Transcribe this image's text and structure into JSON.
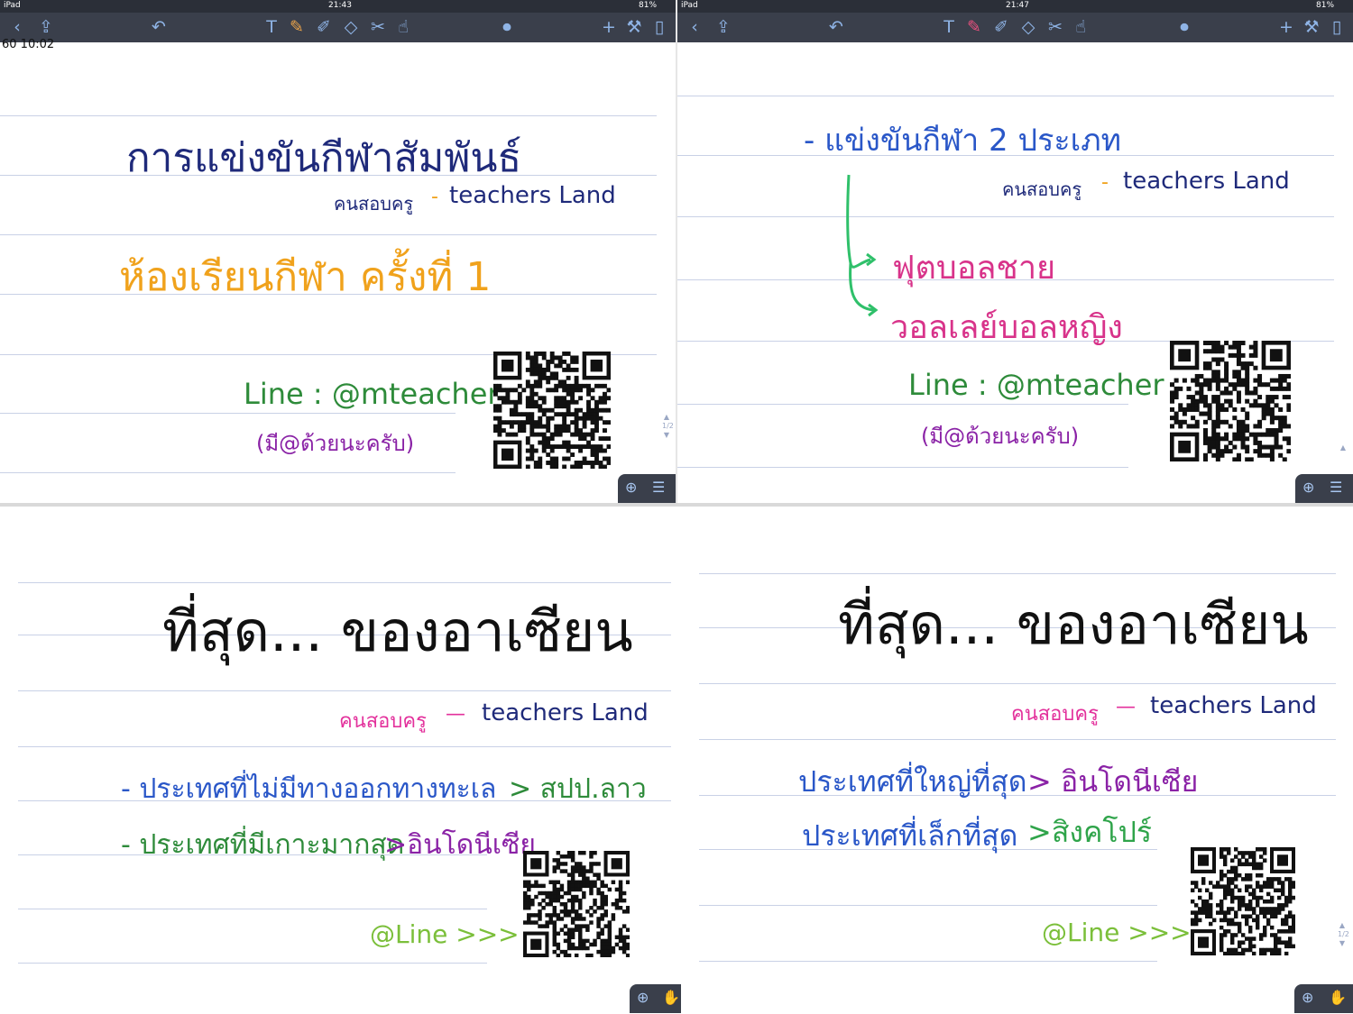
{
  "colors": {
    "toolbar_bg": "#3a3f4b",
    "status_bg": "#2b2f38",
    "rule_line": "#c9d1e6",
    "navy_ink": "#1f2a7a",
    "orange_ink": "#f0a21c",
    "green_ink": "#2e8b3a",
    "purple_ink": "#8a22a6",
    "blue_ink": "#2a57c8",
    "pink_ink": "#d8338a",
    "lime_ink": "#7bbf3a"
  },
  "panel1": {
    "status": {
      "device": "iPad",
      "time": "21:43",
      "battery": "81%"
    },
    "toolbar": {
      "icons": [
        "back-icon",
        "share-icon",
        "undo-icon",
        "text-tool-icon",
        "pencil-icon",
        "highlighter-icon",
        "eraser-icon",
        "lasso-icon",
        "shape-icon",
        "mic-icon",
        "add-icon",
        "wrench-icon",
        "pages-icon"
      ]
    },
    "corner_text": "60 10:02",
    "title": "การแข่งขันกีฬาสัมพันธ์",
    "credit_thai": "คนสอบครู",
    "credit_dash": "-",
    "credit_en": "teachers Land",
    "subtitle": "ห้องเรียนกีฬา ครั้งที่ 1",
    "line_id": "Line : @mteacher",
    "line_note": "(มี@ด้วยนะครับ)"
  },
  "panel2": {
    "status": {
      "device": "iPad",
      "time": "21:47",
      "battery": "81%"
    },
    "heading": "- แข่งขันกีฬา  2 ประเภท",
    "credit_thai": "คนสอบครู",
    "credit_dash": "-",
    "credit_en": "teachers Land",
    "item1": "ฟุตบอลชาย",
    "item2": "วอลเลย์บอลหญิง",
    "line_id": "Line : @mteacher",
    "line_note": "(มี@ด้วยนะครับ)"
  },
  "panel3": {
    "title": "ที่สุด... ของอาเซียน",
    "credit_thai": "คนสอบครู",
    "credit_dash": "—",
    "credit_en": "teachers Land",
    "fact1_label": "- ประเทศที่ไม่มีทางออกทางทะเล",
    "fact1_answer": "> สปป.ลาว",
    "fact2_label": "- ประเทศที่มีเกาะมากสุด",
    "fact2_answer": ">อินโดนีเซีย",
    "line_tag": "@Line  >>>"
  },
  "panel4": {
    "title": "ที่สุด... ของอาเซียน",
    "credit_thai": "คนสอบครู",
    "credit_dash": "—",
    "credit_en": "teachers Land",
    "fact1_label": "ประเทศที่ใหญ่ที่สุด",
    "fact1_answer": "> อินโดนีเซีย",
    "fact2_label": "ประเทศที่เล็กที่สุด",
    "fact2_answer": ">สิงคโปร์",
    "line_tag": "@Line  >>>"
  },
  "fab": {
    "zoom_icon": "zoom-in-icon",
    "menu_icon": "menu-icon",
    "hand_icon": "hand-icon"
  },
  "page_indicator": "1/2"
}
